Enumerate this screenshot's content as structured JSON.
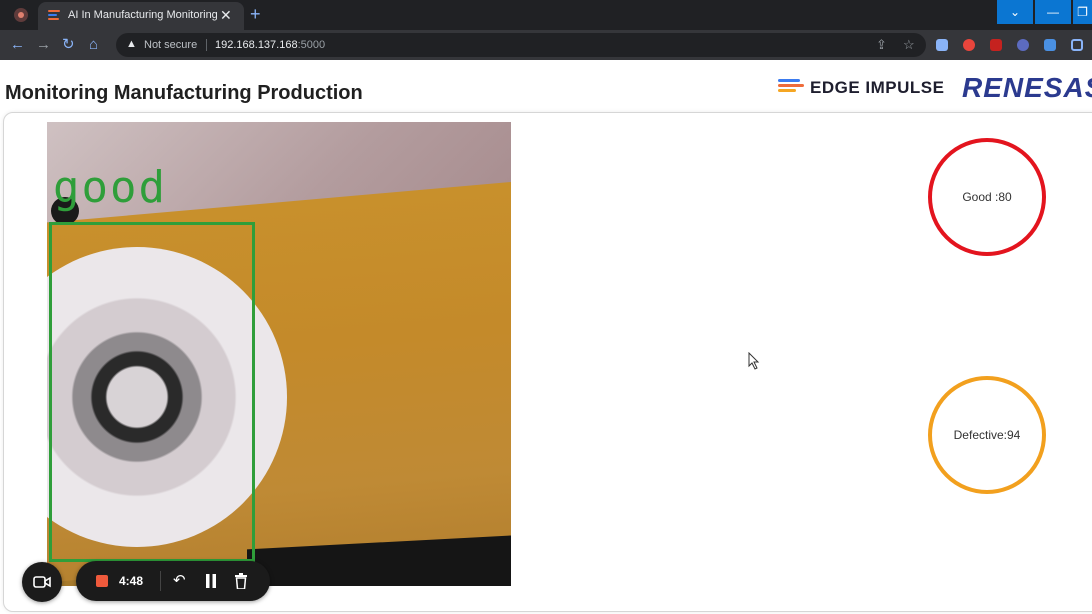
{
  "browser": {
    "active_tab_title": "AI In Manufacturing Monitoring",
    "tab_close": "✕",
    "new_tab": "+",
    "security_label": "Not secure",
    "url_host": "192.168.137.168",
    "url_port": ":5000",
    "window_buttons": [
      "⌄",
      "—",
      "❐"
    ]
  },
  "page": {
    "title": "Monitoring Manufacturing Production",
    "logos": {
      "edge_impulse": "EDGE IMPULSE",
      "renesas": "RENESAS"
    }
  },
  "camera_feed": {
    "detection_label": "good",
    "box_color": "#2f9e3a"
  },
  "counters": {
    "good": {
      "text": "Good :80",
      "ring_color": "#e3141e"
    },
    "defective": {
      "text": "Defective:94",
      "ring_color": "#f2a01e"
    }
  },
  "recorder": {
    "elapsed": "4:48",
    "icons": [
      "camera-icon",
      "stop-icon",
      "undo-icon",
      "pause-icon",
      "trash-icon"
    ]
  },
  "colors": {
    "chrome_dark": "#202124",
    "chrome_toolbar": "#35363a",
    "window_button_blue": "#0b76d2",
    "recorder_stop": "#ef5a3c"
  }
}
